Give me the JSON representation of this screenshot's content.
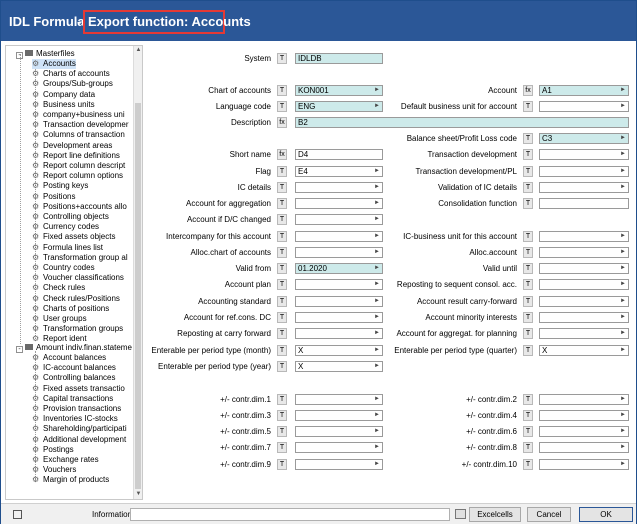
{
  "window": {
    "app_title": "IDL Formula",
    "separator": "-",
    "function_title": "Export function: Accounts"
  },
  "tree": {
    "masterfiles": {
      "label": "Masterfiles",
      "expander": "-",
      "items": [
        "Accounts",
        "Charts of accounts",
        "Groups/Sub-groups",
        "Company data",
        "Business units",
        "company+business uni",
        "Transaction developmer",
        "Columns of transaction",
        "Development areas",
        "Report line definitions",
        "Report column descript",
        "Report column options",
        "Posting keys",
        "Positions",
        "Positions+accounts allo",
        "Controlling objects",
        "Currency codes",
        "Fixed assets objects",
        "Formula lines list",
        "Transformation group al",
        "Country codes",
        "Voucher classifications",
        "Check rules",
        "Check rules/Positions",
        "Charts of positions",
        "User groups",
        "Transformation groups",
        "Report ident"
      ]
    },
    "amount": {
      "label": "Amount indiv.finan.stateme",
      "expander": "-",
      "items": [
        "Account balances",
        "IC-account balances",
        "Controlling balances",
        "Fixed assets transactio",
        "Capital transactions",
        "Provision transactions",
        "Inventories IC-stocks",
        "Shareholding/participati",
        "Additional development",
        "Postings",
        "Exchange rates",
        "Vouchers",
        "Margin of products"
      ]
    }
  },
  "form": {
    "system": {
      "label": "System",
      "btn": "T",
      "value": "IDLDB"
    },
    "chart_of_accounts": {
      "label": "Chart of accounts",
      "btn": "T",
      "value": "KON001"
    },
    "account": {
      "label": "Account",
      "btn": "fx",
      "value": "A1"
    },
    "language_code": {
      "label": "Language code",
      "btn": "T",
      "value": "ENG"
    },
    "default_bu": {
      "label": "Default business unit for account",
      "btn": "T",
      "value": ""
    },
    "description": {
      "label": "Description",
      "btn": "fx",
      "value": "B2"
    },
    "balance_sheet": {
      "label": "Balance sheet/Profit  Loss code",
      "btn": "T",
      "value": "C3"
    },
    "short_name": {
      "label": "Short name",
      "btn": "fx",
      "value": "D4"
    },
    "transaction_dev": {
      "label": "Transaction development",
      "btn": "T",
      "value": ""
    },
    "flag": {
      "label": "Flag",
      "btn": "T",
      "value": "E4"
    },
    "transaction_dev_pl": {
      "label": "Transaction development/PL",
      "btn": "T",
      "value": ""
    },
    "ic_details": {
      "label": "IC details",
      "btn": "T",
      "value": ""
    },
    "validation_ic": {
      "label": "Validation of IC details",
      "btn": "T",
      "value": ""
    },
    "account_aggregation": {
      "label": "Account for aggregation",
      "btn": "T",
      "value": ""
    },
    "consolidation_function": {
      "label": "Consolidation function",
      "btn": "T",
      "value": ""
    },
    "account_dc_changed": {
      "label": "Account if D/C changed",
      "btn": "T",
      "value": ""
    },
    "intercompany": {
      "label": "Intercompany for this account",
      "btn": "T",
      "value": ""
    },
    "ic_business_unit": {
      "label": "IC-business unit for this account",
      "btn": "T",
      "value": ""
    },
    "alloc_chart": {
      "label": "Alloc.chart of accounts",
      "btn": "T",
      "value": ""
    },
    "alloc_account": {
      "label": "Alloc.account",
      "btn": "T",
      "value": ""
    },
    "valid_from": {
      "label": "Valid from",
      "btn": "T",
      "value": "01.2020"
    },
    "valid_until": {
      "label": "Valid until",
      "btn": "T",
      "value": ""
    },
    "account_plan": {
      "label": "Account plan",
      "btn": "T",
      "value": ""
    },
    "reposting_sequent": {
      "label": "Reposting to sequent consol. acc.",
      "btn": "T",
      "value": ""
    },
    "accounting_standard": {
      "label": "Accounting standard",
      "btn": "T",
      "value": ""
    },
    "account_result_cf": {
      "label": "Account result carry-forward",
      "btn": "T",
      "value": ""
    },
    "account_ref_cons": {
      "label": "Account for ref.cons. DC",
      "btn": "T",
      "value": ""
    },
    "account_minority": {
      "label": "Account minority interests",
      "btn": "T",
      "value": ""
    },
    "reposting_cf": {
      "label": "Reposting at carry forward",
      "btn": "T",
      "value": ""
    },
    "account_aggregat_planning": {
      "label": "Account for aggregat. for planning",
      "btn": "T",
      "value": ""
    },
    "enterable_month": {
      "label": "Enterable per period type (month)",
      "btn": "T",
      "value": "X"
    },
    "enterable_quarter": {
      "label": "Enterable per period type (quarter)",
      "btn": "T",
      "value": "X"
    },
    "enterable_year": {
      "label": "Enterable per period type (year)",
      "btn": "T",
      "value": "X"
    },
    "dims": [
      {
        "label": "+/- contr.dim.1",
        "btn": "T"
      },
      {
        "label": "+/- contr.dim.2",
        "btn": "T"
      },
      {
        "label": "+/- contr.dim.3",
        "btn": "T"
      },
      {
        "label": "+/- contr.dim.4",
        "btn": "T"
      },
      {
        "label": "+/- contr.dim.5",
        "btn": "T"
      },
      {
        "label": "+/- contr.dim.6",
        "btn": "T"
      },
      {
        "label": "+/- contr.dim.7",
        "btn": "T"
      },
      {
        "label": "+/- contr.dim.8",
        "btn": "T"
      },
      {
        "label": "+/- contr.dim.9",
        "btn": "T"
      },
      {
        "label": "+/- contr.dim.10",
        "btn": "T"
      }
    ]
  },
  "dropdown_glyph": "►",
  "status": {
    "info_label": "Information",
    "excelcells": "Excelcells",
    "cancel": "Cancel",
    "ok": "OK"
  }
}
